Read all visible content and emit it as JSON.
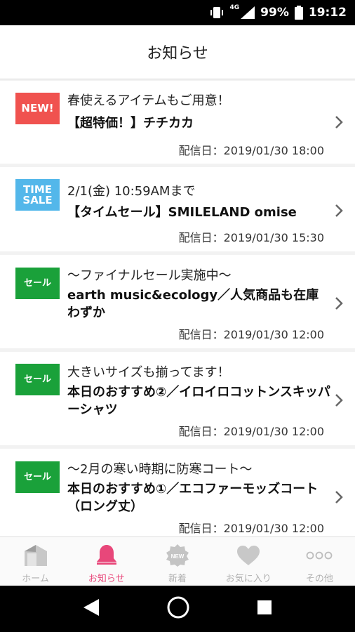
{
  "status_bar": {
    "network": "4G",
    "battery": "99%",
    "time": "19:12"
  },
  "header": {
    "title": "お知らせ"
  },
  "notices": [
    {
      "badge": "NEW!",
      "lead": "春使えるアイテムもご用意！",
      "headline": "【超特価！】チチカカ",
      "date": "配信日：2019/01/30 18:00"
    },
    {
      "badge": "TIME SALE",
      "lead": "2/1(金) 10:59AMまで",
      "headline": "【タイムセール】SMILELAND omise",
      "date": "配信日：2019/01/30 15:30"
    },
    {
      "badge": "セール",
      "lead": "～ファイナルセール実施中～",
      "headline": "earth music&ecology／人気商品も在庫わずか",
      "date": "配信日：2019/01/30 12:00"
    },
    {
      "badge": "セール",
      "lead": "大きいサイズも揃ってます！",
      "headline": "本日のおすすめ②／イロイロコットンスキッパーシャツ",
      "date": "配信日：2019/01/30 12:00"
    },
    {
      "badge": "セール",
      "lead": "～2月の寒い時期に防寒コート～",
      "headline": "本日のおすすめ①／エコファーモッズコート（ロング丈）",
      "date": "配信日：2019/01/30 12:00"
    }
  ],
  "bottom_nav": [
    {
      "label": "ホーム",
      "icon": "home-icon"
    },
    {
      "label": "お知らせ",
      "icon": "bell-icon",
      "active": true
    },
    {
      "label": "新着",
      "icon": "new-badge-icon",
      "icon_text": "NEW"
    },
    {
      "label": "お気に入り",
      "icon": "heart-icon"
    },
    {
      "label": "その他",
      "icon": "more-icon"
    }
  ],
  "colors": {
    "new_badge": "#f0524f",
    "time_badge": "#53b7ea",
    "sale_badge": "#1aa13a",
    "active_nav": "#e8477a",
    "inactive_nav": "#b0b0b0"
  }
}
